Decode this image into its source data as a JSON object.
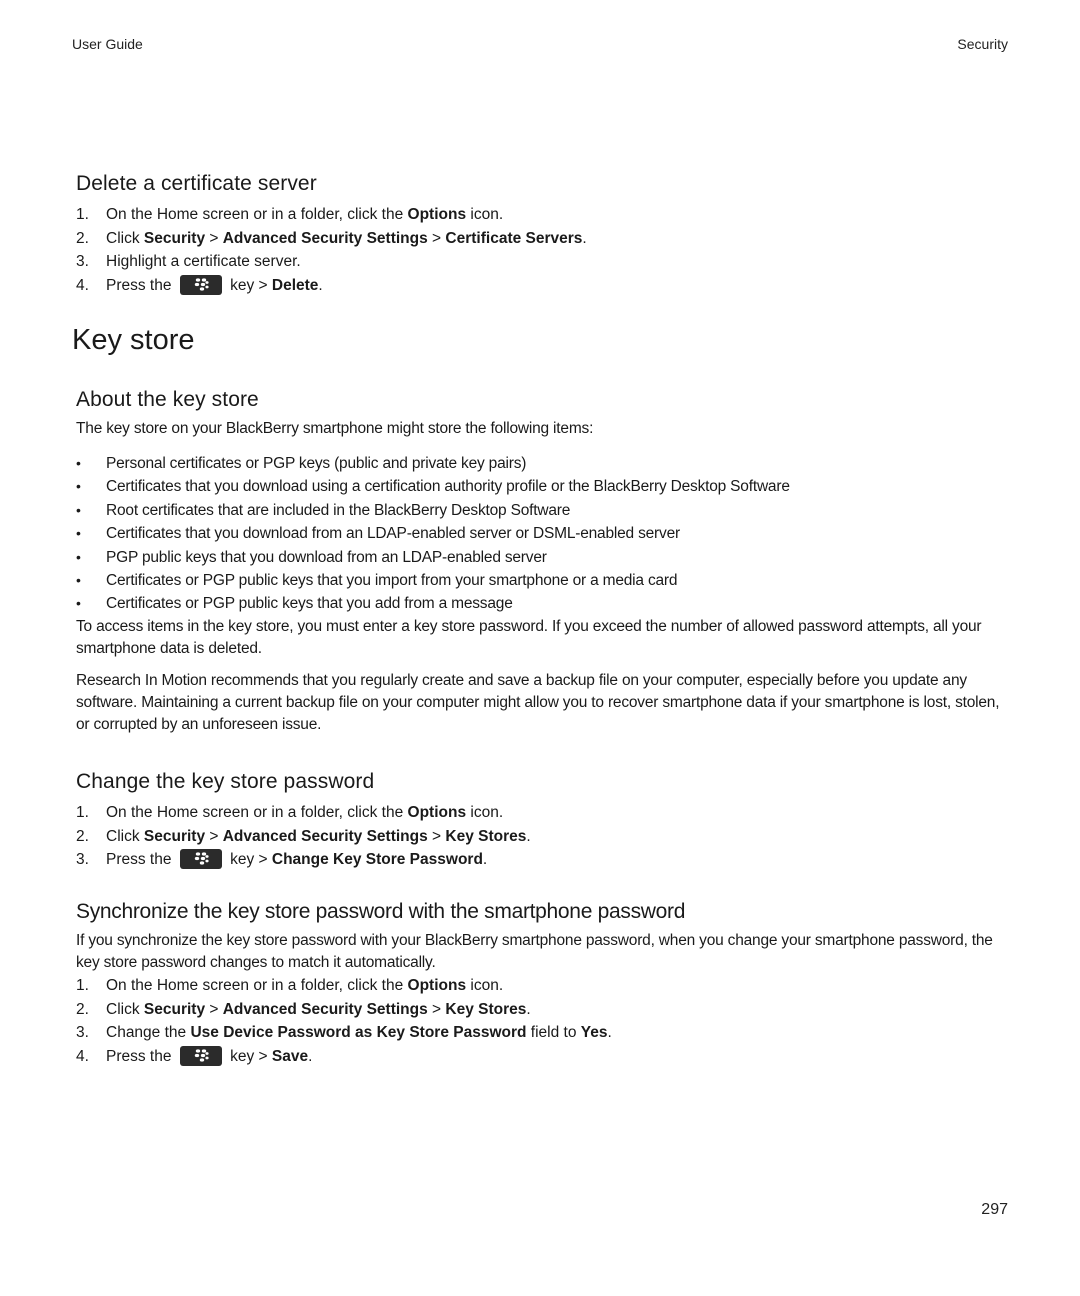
{
  "header": {
    "left": "User Guide",
    "right": "Security"
  },
  "page_number": "297",
  "sections": {
    "delete_cert_server": {
      "title": "Delete a certificate server",
      "steps": [
        {
          "num": "1.",
          "parts": [
            {
              "t": "On the Home screen or in a folder, click the "
            },
            {
              "b": "Options"
            },
            {
              "t": " icon."
            }
          ]
        },
        {
          "num": "2.",
          "parts": [
            {
              "t": "Click "
            },
            {
              "b": "Security"
            },
            {
              "t": " > "
            },
            {
              "b": "Advanced Security Settings"
            },
            {
              "t": " > "
            },
            {
              "b": "Certificate Servers"
            },
            {
              "t": "."
            }
          ]
        },
        {
          "num": "3.",
          "parts": [
            {
              "t": "Highlight a certificate server."
            }
          ]
        },
        {
          "num": "4.",
          "parts": [
            {
              "t": "Press the "
            },
            {
              "key": "blackberry-menu-key"
            },
            {
              "t": " key > "
            },
            {
              "b": "Delete"
            },
            {
              "t": "."
            }
          ]
        }
      ]
    },
    "key_store": {
      "title": "Key store"
    },
    "about_key_store": {
      "title": "About the key store",
      "intro": "The key store on your BlackBerry smartphone might store the following items:",
      "bullets": [
        "Personal certificates or PGP keys (public and private key pairs)",
        "Certificates that you download using a certification authority profile or the BlackBerry Desktop Software",
        "Root certificates that are included in the BlackBerry Desktop Software",
        "Certificates that you download from an LDAP-enabled server or DSML-enabled server",
        "PGP public keys that you download from an LDAP-enabled server",
        "Certificates or PGP public keys that you import from your smartphone or a media card",
        "Certificates or PGP public keys that you add from a message"
      ],
      "para1": "To access items in the key store, you must enter a key store password. If you exceed the number of allowed password attempts, all your smartphone data is deleted.",
      "para2": "Research In Motion recommends that you regularly create and save a backup file on your computer, especially before you update any software. Maintaining a current backup file on your computer might allow you to recover smartphone data if your smartphone is lost, stolen, or corrupted by an unforeseen issue."
    },
    "change_password": {
      "title": "Change the key store password",
      "steps": [
        {
          "num": "1.",
          "parts": [
            {
              "t": "On the Home screen or in a folder, click the "
            },
            {
              "b": "Options"
            },
            {
              "t": " icon."
            }
          ]
        },
        {
          "num": "2.",
          "parts": [
            {
              "t": "Click "
            },
            {
              "b": "Security"
            },
            {
              "t": " > "
            },
            {
              "b": "Advanced Security Settings"
            },
            {
              "t": " > "
            },
            {
              "b": "Key Stores"
            },
            {
              "t": "."
            }
          ]
        },
        {
          "num": "3.",
          "parts": [
            {
              "t": "Press the "
            },
            {
              "key": "blackberry-menu-key"
            },
            {
              "t": " key > "
            },
            {
              "b": "Change Key Store Password"
            },
            {
              "t": "."
            }
          ]
        }
      ]
    },
    "sync_password": {
      "title": "Synchronize the key store password with the smartphone password",
      "intro": "If you synchronize the key store password with your BlackBerry smartphone password, when you change your smartphone password, the key store password changes to match it automatically.",
      "steps": [
        {
          "num": "1.",
          "parts": [
            {
              "t": "On the Home screen or in a folder, click the "
            },
            {
              "b": "Options"
            },
            {
              "t": " icon."
            }
          ]
        },
        {
          "num": "2.",
          "parts": [
            {
              "t": "Click "
            },
            {
              "b": "Security"
            },
            {
              "t": " > "
            },
            {
              "b": "Advanced Security Settings"
            },
            {
              "t": " > "
            },
            {
              "b": "Key Stores"
            },
            {
              "t": "."
            }
          ]
        },
        {
          "num": "3.",
          "parts": [
            {
              "t": "Change the "
            },
            {
              "b": "Use Device Password as Key Store Password"
            },
            {
              "t": " field to "
            },
            {
              "b": "Yes"
            },
            {
              "t": "."
            }
          ]
        },
        {
          "num": "4.",
          "parts": [
            {
              "t": "Press the "
            },
            {
              "key": "blackberry-menu-key"
            },
            {
              "t": " key > "
            },
            {
              "b": "Save"
            },
            {
              "t": "."
            }
          ]
        }
      ]
    }
  }
}
